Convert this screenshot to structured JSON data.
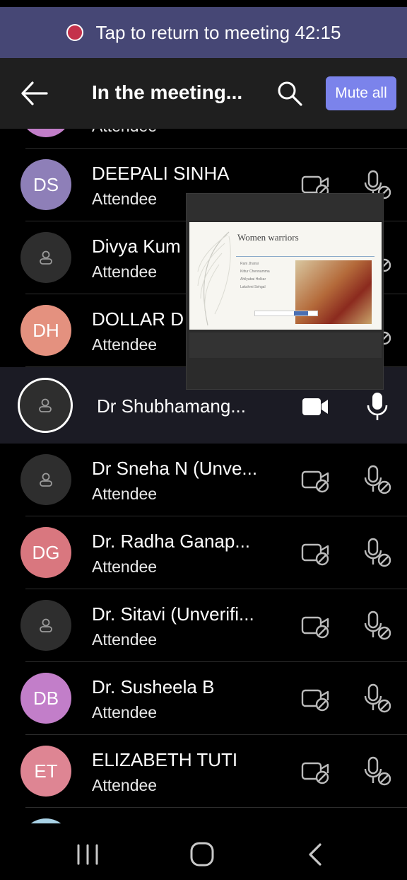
{
  "banner": {
    "text": "Tap to return to meeting 42:15"
  },
  "header": {
    "title": "In the meeting...",
    "mute_all_label": "Mute all"
  },
  "partial_row": {
    "role": "Attendee"
  },
  "participants": [
    {
      "initials": "DS",
      "name": "DEEPALI SINHA",
      "role": "Attendee",
      "avatar_color": "#8e7fb8"
    },
    {
      "initials": "",
      "name": "Divya Kum",
      "role": "Attendee",
      "avatar_color": "#2e2e2e"
    },
    {
      "initials": "DH",
      "name": "DOLLAR D",
      "role": "Attendee",
      "avatar_color": "#e4917f"
    },
    {
      "initials": "",
      "name": "Dr Shubhamang...",
      "role": "",
      "avatar_color": "#2e2e2e"
    },
    {
      "initials": "",
      "name": "Dr Sneha N (Unve...",
      "role": "Attendee",
      "avatar_color": "#2e2e2e"
    },
    {
      "initials": "DG",
      "name": "Dr. Radha Ganap...",
      "role": "Attendee",
      "avatar_color": "#d9777f"
    },
    {
      "initials": "",
      "name": "Dr. Sitavi (Unverifi...",
      "role": "Attendee",
      "avatar_color": "#2e2e2e"
    },
    {
      "initials": "DB",
      "name": "Dr. Susheela B",
      "role": "Attendee",
      "avatar_color": "#c27ec9"
    },
    {
      "initials": "ET",
      "name": "ELIZABETH TUTI",
      "role": "Attendee",
      "avatar_color": "#de8593"
    }
  ],
  "shared_slide": {
    "title": "Women warriors",
    "items": [
      "Rani Jhansi",
      "Kittur Chennamma",
      "Ahilyabai Holkar",
      "Lakshmi Sehgal"
    ]
  },
  "colors": {
    "banner": "#464775",
    "accent": "#7b83eb",
    "record": "#c4314b"
  }
}
